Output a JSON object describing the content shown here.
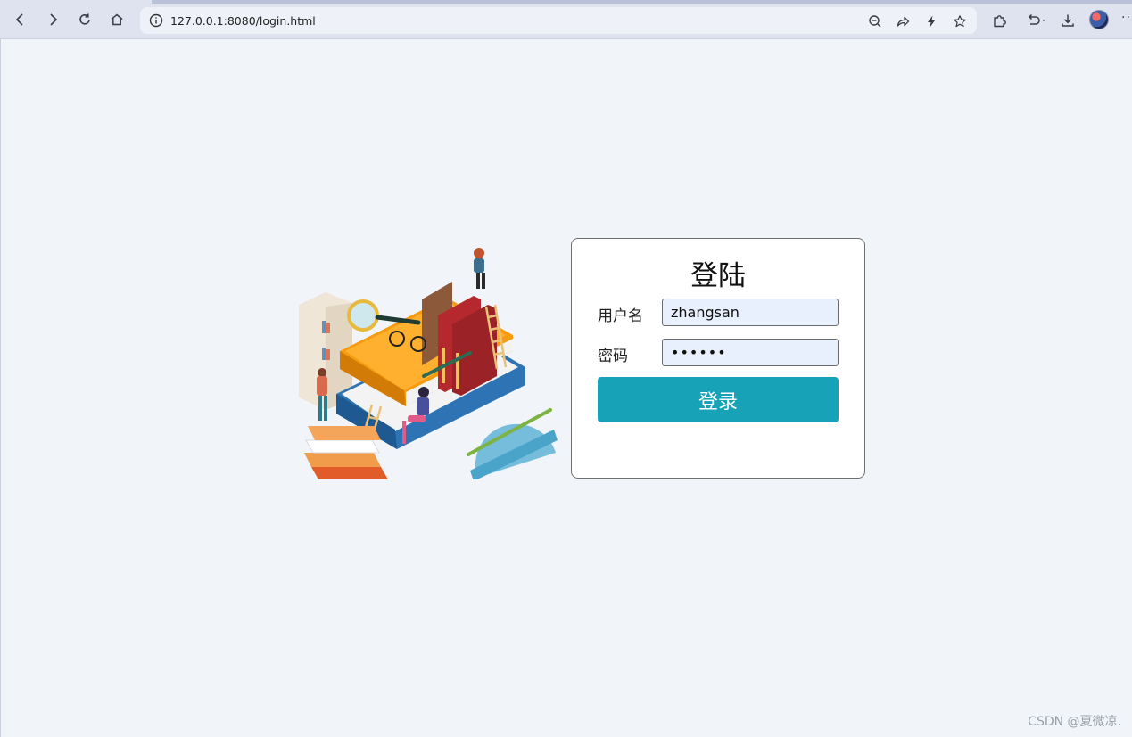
{
  "browser": {
    "url": "127.0.0.1:8080/login.html",
    "icons": {
      "back": "back-arrow-icon",
      "forward": "forward-arrow-icon",
      "reload": "reload-icon",
      "home": "home-icon",
      "site_info": "info-icon",
      "zoom": "zoom-out-icon",
      "share": "share-icon",
      "lightning": "lightning-icon",
      "bookmark": "star-icon",
      "extensions": "puzzle-icon",
      "undo": "undo-icon",
      "download": "download-icon",
      "more": "more-icon"
    },
    "more_label": "···"
  },
  "login": {
    "title": "登陆",
    "username_label": "用户名",
    "username_value": "zhangsan",
    "password_label": "密码",
    "password_value": "••••••",
    "submit_label": "登录",
    "accent_color": "#17a2b8"
  },
  "watermark": "CSDN @夏微凉."
}
